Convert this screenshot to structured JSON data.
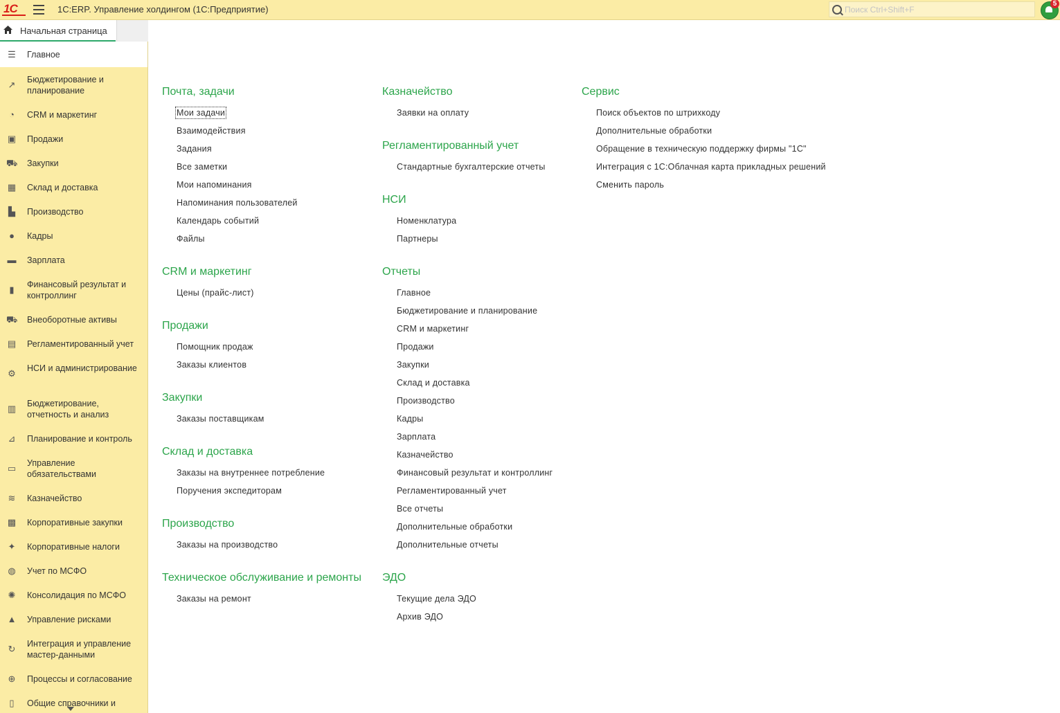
{
  "app": {
    "logo": "1С",
    "title": "1С:ERP. Управление холдингом  (1С:Предприятие)",
    "search_placeholder": "Поиск Ctrl+Shift+F",
    "notifications_count": "5"
  },
  "tabs": {
    "home": "Начальная страница"
  },
  "sidebar": {
    "items": [
      {
        "label": "Главное",
        "icon": "menu-lines-icon"
      },
      {
        "label": "Бюджетирование и планирование",
        "icon": "chart-growth-icon"
      },
      {
        "label": "CRM и маркетинг",
        "icon": "pie-chart-icon"
      },
      {
        "label": "Продажи",
        "icon": "bag-icon"
      },
      {
        "label": "Закупки",
        "icon": "cart-icon"
      },
      {
        "label": "Склад и доставка",
        "icon": "warehouse-icon"
      },
      {
        "label": "Производство",
        "icon": "factory-icon"
      },
      {
        "label": "Кадры",
        "icon": "person-icon"
      },
      {
        "label": "Зарплата",
        "icon": "wallet-icon"
      },
      {
        "label": "Финансовый результат и контроллинг",
        "icon": "bar-chart-icon"
      },
      {
        "label": "Внеоборотные активы",
        "icon": "truck-icon"
      },
      {
        "label": "Регламентированный учет",
        "icon": "calculator-icon"
      },
      {
        "label": "НСИ и администрирование",
        "icon": "gear-icon"
      },
      {
        "label": "Бюджетирование, отчетность и анализ",
        "icon": "report-chart-icon"
      },
      {
        "label": "Планирование и контроль",
        "icon": "plan-icon"
      },
      {
        "label": "Управление обязательствами",
        "icon": "briefcase-icon"
      },
      {
        "label": "Казначейство",
        "icon": "coins-icon"
      },
      {
        "label": "Корпоративные закупки",
        "icon": "gift-icon"
      },
      {
        "label": "Корпоративные налоги",
        "icon": "emblem-icon"
      },
      {
        "label": "Учет по МСФО",
        "icon": "globe-icon"
      },
      {
        "label": "Консолидация по МСФО",
        "icon": "atom-icon"
      },
      {
        "label": "Управление рисками",
        "icon": "extinguisher-icon"
      },
      {
        "label": "Интеграция и управление мастер-данными",
        "icon": "sync-icon"
      },
      {
        "label": "Процессы и согласование",
        "icon": "process-icon"
      },
      {
        "label": "Общие справочники и",
        "icon": "book-icon"
      }
    ]
  },
  "content": {
    "col1": [
      {
        "title": "Почта, задачи",
        "links": [
          "Мои задачи",
          "Взаимодействия",
          "Задания",
          "Все заметки",
          "Мои напоминания",
          "Напоминания пользователей",
          "Календарь событий",
          "Файлы"
        ]
      },
      {
        "title": "CRM и маркетинг",
        "links": [
          "Цены (прайс-лист)"
        ]
      },
      {
        "title": "Продажи",
        "links": [
          "Помощник продаж",
          "Заказы клиентов"
        ]
      },
      {
        "title": "Закупки",
        "links": [
          "Заказы поставщикам"
        ]
      },
      {
        "title": "Склад и доставка",
        "links": [
          "Заказы на внутреннее потребление",
          "Поручения экспедиторам"
        ]
      },
      {
        "title": "Производство",
        "links": [
          "Заказы на производство"
        ]
      },
      {
        "title": "Техническое обслуживание и ремонты",
        "links": [
          "Заказы на ремонт"
        ]
      }
    ],
    "col2": [
      {
        "title": "Казначейство",
        "links": [
          "Заявки на оплату"
        ]
      },
      {
        "title": "Регламентированный учет",
        "links": [
          "Стандартные бухгалтерские отчеты"
        ]
      },
      {
        "title": "НСИ",
        "links": [
          "Номенклатура",
          "Партнеры"
        ]
      },
      {
        "title": "Отчеты",
        "links": [
          "Главное",
          "Бюджетирование и планирование",
          "CRM и маркетинг",
          "Продажи",
          "Закупки",
          "Склад и доставка",
          "Производство",
          "Кадры",
          "Зарплата",
          "Казначейство",
          "Финансовый результат и контроллинг",
          "Регламентированный учет",
          "Все отчеты",
          "Дополнительные обработки",
          "Дополнительные отчеты"
        ]
      },
      {
        "title": "ЭДО",
        "links": [
          "Текущие дела ЭДО",
          "Архив ЭДО"
        ]
      }
    ],
    "col3": [
      {
        "title": "Сервис",
        "links": [
          "Поиск объектов по штрихкоду",
          "Дополнительные обработки",
          "Обращение в техническую поддержку фирмы \"1С\"",
          "Интеграция с 1С:Облачная карта прикладных решений",
          "Сменить пароль"
        ]
      }
    ]
  },
  "colors": {
    "accent": "#2ca54b",
    "panel": "#fbeca5"
  }
}
